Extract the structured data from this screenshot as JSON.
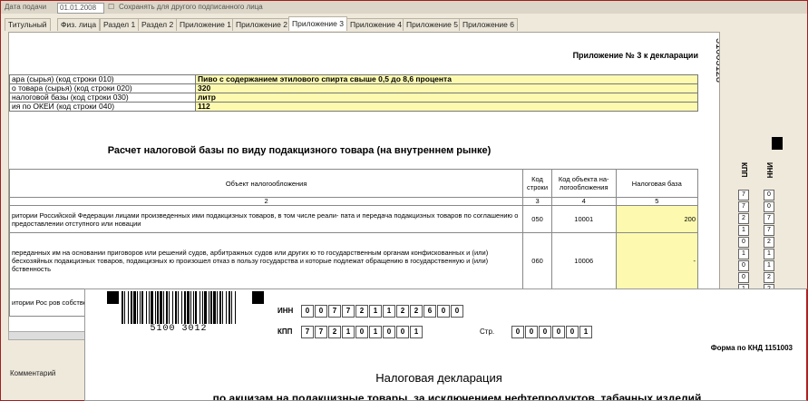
{
  "top_bar": {
    "label": "Дата подачи",
    "date": "01.01.2008",
    "note": "Сохранять для другого подписанного лица"
  },
  "tabs": [
    {
      "label": "Титульный"
    },
    {
      "label": "Физ. лица"
    },
    {
      "label": "Раздел 1"
    },
    {
      "label": "Раздел 2"
    },
    {
      "label": "Приложение 1"
    },
    {
      "label": "Приложение 2"
    },
    {
      "label": "Приложение 3",
      "active": true
    },
    {
      "label": "Приложение 4"
    },
    {
      "label": "Приложение 5"
    },
    {
      "label": "Приложение 6"
    }
  ],
  "sheet": {
    "title": "Приложение № 3 к декларации",
    "barcode_vertical": "51003128",
    "info_rows": [
      {
        "label": "ара (сырья) (код строки 010)",
        "value": "Пиво с содержанием этилового спирта свыше 0,5 до 8,6 процента"
      },
      {
        "label": "о товара (сырья) (код строки 020)",
        "value": "320"
      },
      {
        "label": "налоговой базы (код строки 030)",
        "value": "литр"
      },
      {
        "label": "ия по ОКЕИ (код строки 040)",
        "value": "112"
      }
    ],
    "calc_heading": "Расчет налоговой базы по виду подакцизного товара (на внутреннем рынке)",
    "columns": [
      "Объект налогообложения",
      "Код строки",
      "Код объекта на- логообложения",
      "Налоговая база"
    ],
    "column_numbers": [
      "2",
      "3",
      "4",
      "5"
    ],
    "rows": [
      {
        "object": "ритории Российской Федерации лицами произведенных ими подакцизных товаров, в том числе реали- пата и передача подакцизных товаров по соглашению о предоставлении отступного или новации",
        "code": "050",
        "object_code": "10001",
        "base": "200"
      },
      {
        "object": "переданных им на основании приговоров или решений судов, арбитражных судов или других ю то государственным органам конфискованных и (или) бесхозяйных подакцизных товаров, подакцизных ю произошел отказ в пользу государства и которые подлежат обращению в государственную и (или) бственность",
        "code": "060",
        "object_code": "10006",
        "base": "-"
      },
      {
        "object": "итории Рос ров собстве роз и собстве",
        "code": "",
        "object_code": "",
        "base": ""
      }
    ],
    "side_labels": {
      "inn": "ИНН",
      "kpp": "КПП"
    },
    "side_inn_digits": [
      "0",
      "0",
      "7",
      "7",
      "2",
      "1",
      "1",
      "2",
      "2"
    ],
    "side_kpp_digits": [
      "7",
      "7",
      "2",
      "1",
      "0",
      "1",
      "0",
      "0",
      "1"
    ]
  },
  "comment_label": "Комментарий",
  "front": {
    "barcode_number": "5100 3012",
    "inn_label": "ИНН",
    "inn_digits": [
      "0",
      "0",
      "7",
      "7",
      "2",
      "1",
      "1",
      "2",
      "2",
      "6",
      "0",
      "0"
    ],
    "kpp_label": "КПП",
    "kpp_digits": [
      "7",
      "7",
      "2",
      "1",
      "0",
      "1",
      "0",
      "0",
      "1"
    ],
    "page_label": "Стр.",
    "page_digits": [
      "0",
      "0",
      "0",
      "0",
      "0",
      "1"
    ],
    "knd_form": "Форма по КНД 1151003",
    "title": "Налоговая декларация",
    "subtitle": "по акцизам на подакцизные товары, за исключением нефтепродуктов, табачных изделий"
  }
}
